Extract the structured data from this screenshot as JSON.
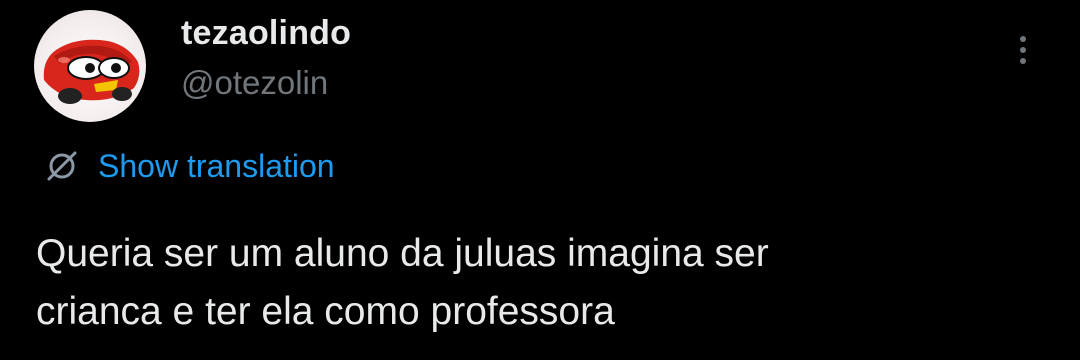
{
  "tweet": {
    "author": {
      "display_name": "tezaolindo",
      "handle": "@otezolin",
      "avatar_icon": "cartoon-race-car-avatar"
    },
    "more_icon": "more-vertical-icon",
    "translation": {
      "icon": "translate-globe-icon",
      "label": "Show translation"
    },
    "text_lines": [
      "Queria ser um aluno da juluas imagina ser",
      "crianca e ter ela como professora"
    ]
  },
  "colors": {
    "background": "#000000",
    "primary_text": "#e7e9ea",
    "secondary_text": "#71767b",
    "link_blue": "#1d9bf0",
    "avatar_red": "#d8261c"
  }
}
